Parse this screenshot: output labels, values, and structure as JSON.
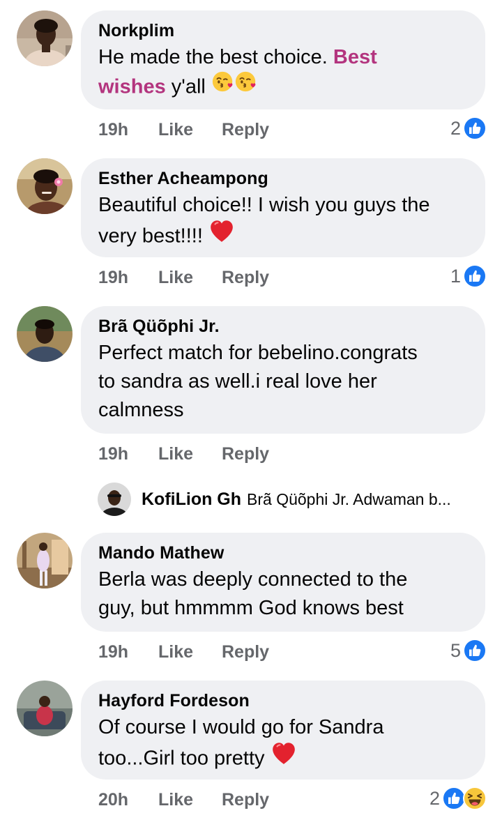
{
  "comments": [
    {
      "author": "Norkplim",
      "text_part1": "He made the best choice. ",
      "highlight1": "Best",
      "highlight2": "wishes",
      "text_part2": " y'all",
      "emojis": [
        "kissing-face-with-heart-emoji",
        "kissing-face-with-heart-emoji"
      ],
      "time": "19h",
      "like_label": "Like",
      "reply_label": "Reply",
      "reaction_count": "2",
      "reactions": [
        "like-icon"
      ]
    },
    {
      "author": "Esther Acheampong",
      "line1": "Beautiful choice!! I wish you guys the",
      "line2": "very best!!!! ",
      "emojis": [
        "red-heart-emoji"
      ],
      "time": "19h",
      "like_label": "Like",
      "reply_label": "Reply",
      "reaction_count": "1",
      "reactions": [
        "like-icon"
      ]
    },
    {
      "author": "Brã Qüõphi Jr.",
      "line1": "Perfect match for bebelino.congrats",
      "line2": "to sandra as well.i real love her",
      "line3": "calmness",
      "time": "19h",
      "like_label": "Like",
      "reply_label": "Reply",
      "reply_preview": {
        "author": "KofiLion Gh",
        "snippet": "Brã Qüõphi Jr.  Adwaman b..."
      }
    },
    {
      "author": "Mando Mathew",
      "line1": "Berla was deeply connected to the",
      "line2": "guy, but hmmmm God knows best",
      "time": "19h",
      "like_label": "Like",
      "reply_label": "Reply",
      "reaction_count": "5",
      "reactions": [
        "like-icon"
      ]
    },
    {
      "author": "Hayford Fordeson",
      "line1": "Of course I would go for Sandra",
      "line2": "too...Girl too pretty ",
      "emojis": [
        "red-heart-emoji"
      ],
      "time": "20h",
      "like_label": "Like",
      "reply_label": "Reply",
      "reaction_count": "2",
      "reactions": [
        "like-icon",
        "haha-icon"
      ]
    }
  ],
  "colors": {
    "bubble": "#eff0f3",
    "highlight": "#b3347e",
    "meta": "#65676b",
    "like_blue": "#1877f2"
  }
}
